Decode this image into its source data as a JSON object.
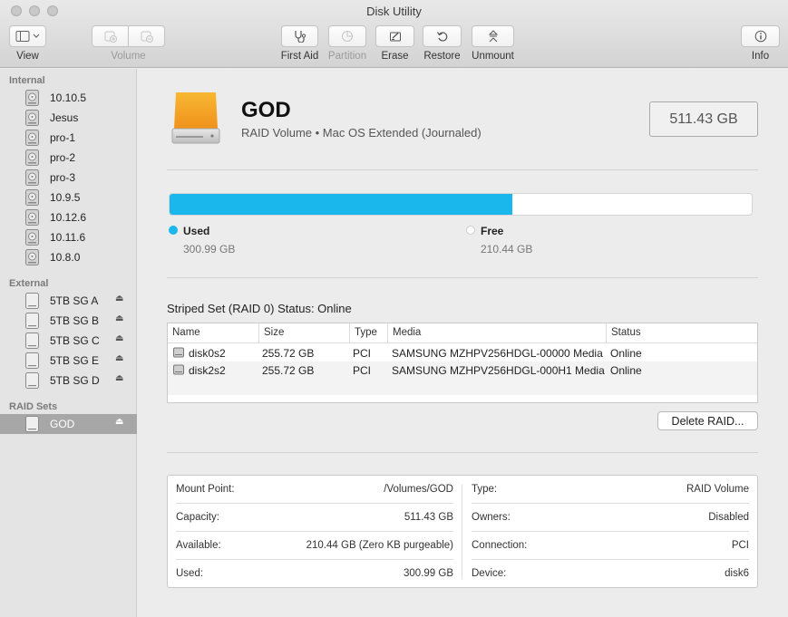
{
  "window": {
    "title": "Disk Utility"
  },
  "toolbar": {
    "view_label": "View",
    "volume_label": "Volume",
    "first_aid_label": "First Aid",
    "partition_label": "Partition",
    "erase_label": "Erase",
    "restore_label": "Restore",
    "unmount_label": "Unmount",
    "info_label": "Info"
  },
  "sidebar": {
    "internal_header": "Internal",
    "internal": [
      {
        "label": "10.10.5"
      },
      {
        "label": "Jesus"
      },
      {
        "label": "pro-1"
      },
      {
        "label": "pro-2"
      },
      {
        "label": "pro-3"
      },
      {
        "label": "10.9.5"
      },
      {
        "label": "10.12.6"
      },
      {
        "label": "10.11.6"
      },
      {
        "label": "10.8.0"
      }
    ],
    "external_header": "External",
    "external": [
      {
        "label": "5TB SG A"
      },
      {
        "label": "5TB SG B"
      },
      {
        "label": "5TB SG C"
      },
      {
        "label": "5TB SG E"
      },
      {
        "label": "5TB SG D"
      }
    ],
    "raid_header": "RAID Sets",
    "raid": [
      {
        "label": "GOD",
        "selected": true
      }
    ],
    "eject_glyph": "⏏"
  },
  "volume": {
    "name": "GOD",
    "description": "RAID Volume • Mac OS Extended (Journaled)",
    "capacity": "511.43 GB"
  },
  "usage": {
    "used_fraction": 0.5884,
    "used_label": "Used",
    "used_value": "300.99 GB",
    "free_label": "Free",
    "free_value": "210.44 GB",
    "used_color": "#1ab7ec",
    "free_color": "#ffffff"
  },
  "raid": {
    "status": "Striped Set (RAID 0) Status: Online",
    "columns": [
      "Name",
      "Size",
      "Type",
      "Media",
      "Status"
    ],
    "rows": [
      {
        "name": "disk0s2",
        "size": "255.72 GB",
        "type": "PCI",
        "media": "SAMSUNG MZHPV256HDGL-00000 Media",
        "status": "Online"
      },
      {
        "name": "disk2s2",
        "size": "255.72 GB",
        "type": "PCI",
        "media": "SAMSUNG MZHPV256HDGL-000H1 Media",
        "status": "Online"
      }
    ],
    "delete_label": "Delete RAID..."
  },
  "info": {
    "mount_point_key": "Mount Point:",
    "mount_point": "/Volumes/GOD",
    "capacity_key": "Capacity:",
    "capacity": "511.43 GB",
    "available_key": "Available:",
    "available": "210.44 GB (Zero KB purgeable)",
    "used_key": "Used:",
    "used": "300.99 GB",
    "type_key": "Type:",
    "type": "RAID Volume",
    "owners_key": "Owners:",
    "owners": "Disabled",
    "connection_key": "Connection:",
    "connection": "PCI",
    "device_key": "Device:",
    "device": "disk6"
  },
  "colors": {
    "accent": "#1ab7ec",
    "drive_orange": "#f5a623",
    "sidebar_selected": "#a7a7a7"
  }
}
